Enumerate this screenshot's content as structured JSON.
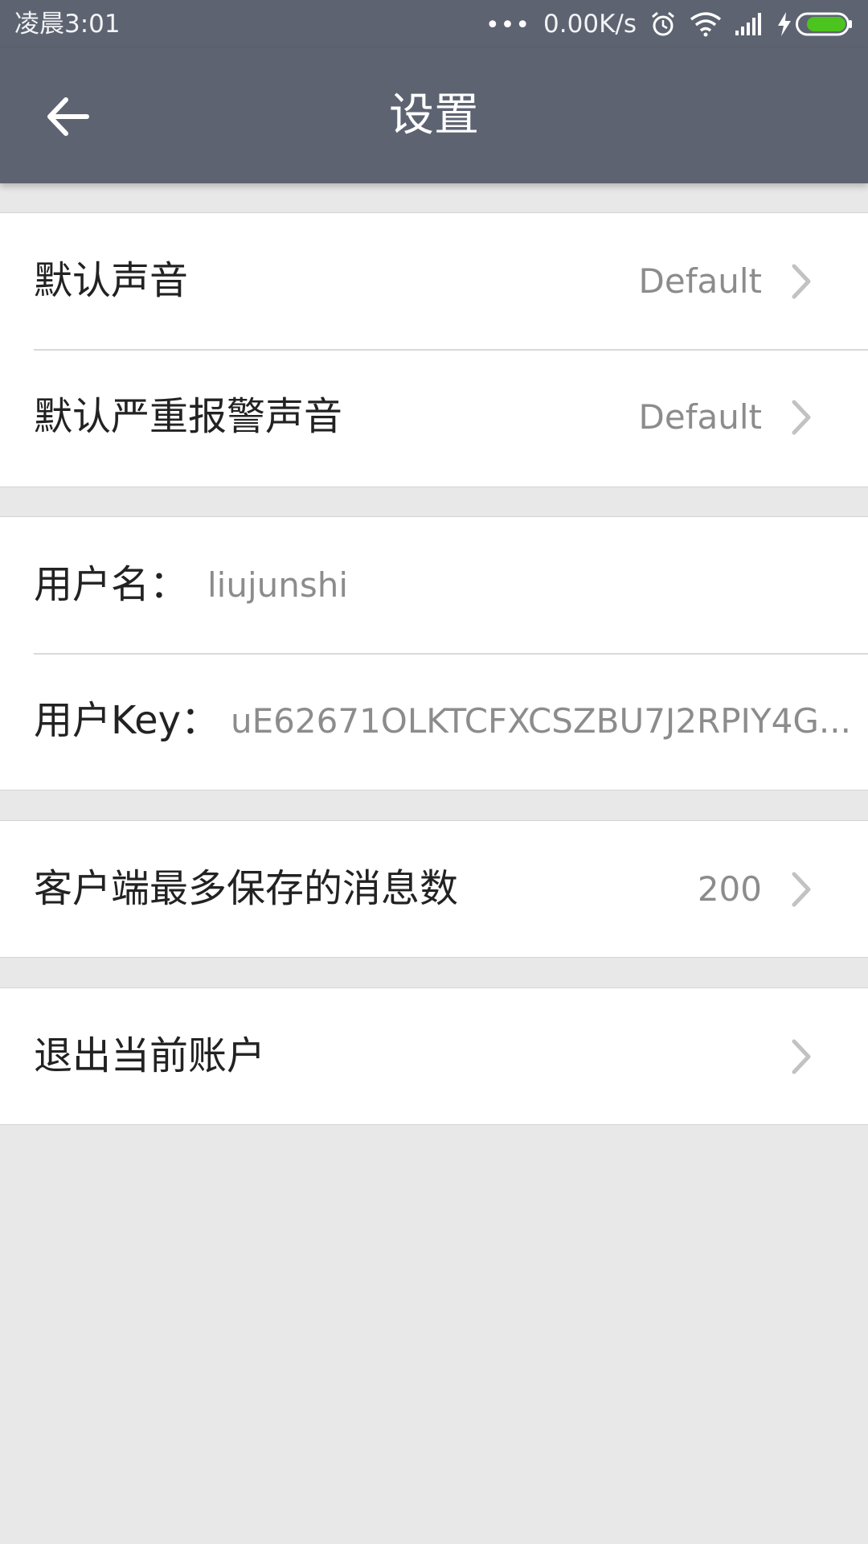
{
  "status_bar": {
    "time": "凌晨3:01",
    "dots": "•••",
    "network_speed": "0.00K/s",
    "icons": [
      "alarm-icon",
      "wifi-icon",
      "signal-icon",
      "charging-icon",
      "battery-icon"
    ],
    "battery_color": "#4cc41f"
  },
  "header": {
    "title": "设置",
    "back_icon": "arrow-left-icon",
    "background": "#5d6371"
  },
  "sound_settings": {
    "default_sound": {
      "label": "默认声音",
      "value": "Default"
    },
    "severe_alarm_sound": {
      "label": "默认严重报警声音",
      "value": "Default"
    }
  },
  "account_info": {
    "username": {
      "label": "用户名：",
      "value": "liujunshi"
    },
    "user_key": {
      "label": "用户Key：",
      "value": "uE62671OLKTCFXCSZBU7J2RPIY4G..."
    }
  },
  "message_settings": {
    "max_messages": {
      "label": "客户端最多保存的消息数",
      "value": "200"
    }
  },
  "logout": {
    "label": "退出当前账户"
  }
}
